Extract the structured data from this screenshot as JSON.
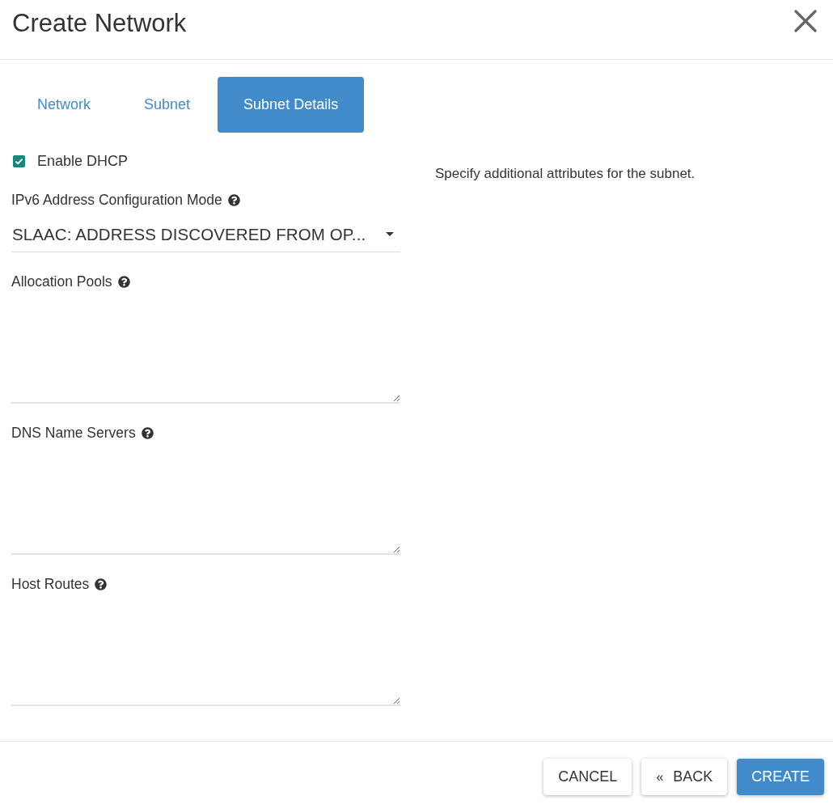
{
  "dialog": {
    "title": "Create Network"
  },
  "tabs": [
    {
      "label": "Network",
      "selected": false
    },
    {
      "label": "Subnet",
      "selected": false
    },
    {
      "label": "Subnet Details",
      "selected": true
    }
  ],
  "form": {
    "enable_dhcp": {
      "label": "Enable DHCP",
      "checked": true
    },
    "ipv6_mode": {
      "label": "IPv6 Address Configuration Mode",
      "value": "SLAAC: ADDRESS DISCOVERED FROM OP..."
    },
    "textareas": [
      {
        "label": "Allocation Pools"
      },
      {
        "label": "DNS Name Servers"
      },
      {
        "label": "Host Routes"
      }
    ]
  },
  "help_text": "Specify additional attributes for the subnet.",
  "buttons": [
    {
      "label": "CANCEL",
      "kind": "default"
    },
    {
      "label": "BACK",
      "icon": "«",
      "kind": "back"
    },
    {
      "label": "CREATE",
      "kind": "primary"
    }
  ]
}
